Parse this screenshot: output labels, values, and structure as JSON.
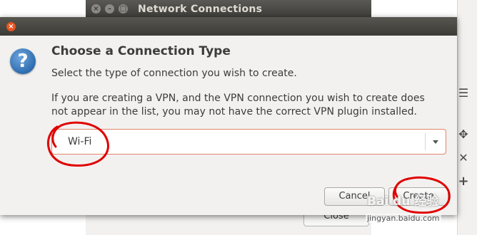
{
  "background_window": {
    "title": "Network Connections",
    "close_button": "Close"
  },
  "dialog": {
    "heading": "Choose a Connection Type",
    "description": "Select the type of connection you wish to create.",
    "vpn_note": "If you are creating a VPN, and the VPN connection you wish to create does not appear in the list, you may not have the correct VPN plugin installed.",
    "connection_type": {
      "selected": "Wi-Fi"
    },
    "buttons": {
      "cancel": "Cancel",
      "create": "Create"
    }
  },
  "watermark": {
    "brand": "Bai du 经验",
    "url": "jingyan.baidu.com"
  },
  "icons": [
    "question-icon",
    "close-icon",
    "dropdown-arrow-icon",
    "list-icon",
    "move-icon",
    "remove-icon",
    "add-icon"
  ],
  "colors": {
    "accent": "#e95420",
    "titlebar": "#3c3b37",
    "annotation": "#e00000"
  }
}
